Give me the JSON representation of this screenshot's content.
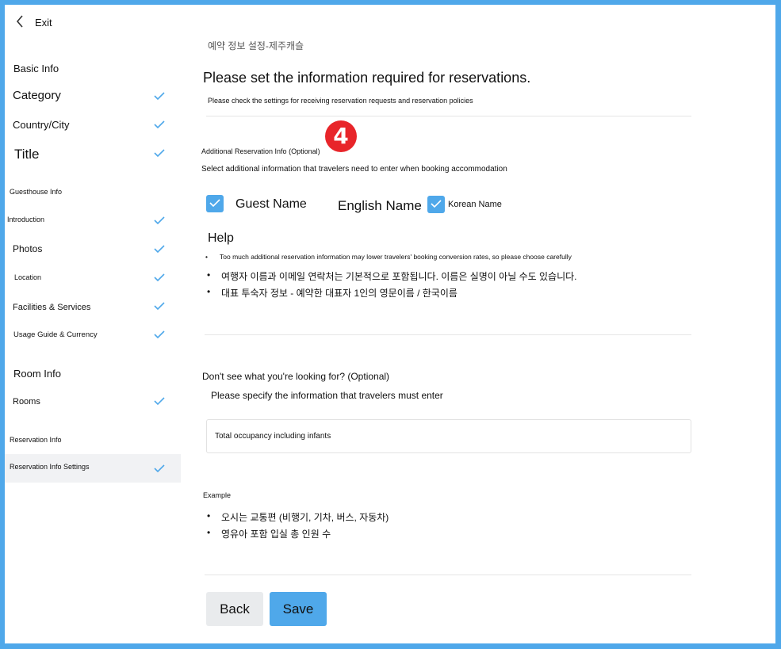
{
  "header": {
    "back_label": "Exit"
  },
  "sidebar": {
    "basic_info_heading": "Basic Info",
    "items": [
      {
        "label": "Category",
        "checked": true
      },
      {
        "label": "Country/City",
        "checked": true
      },
      {
        "label": "Title",
        "checked": true
      },
      {
        "label": "Guesthouse Info",
        "heading": true
      },
      {
        "label": "Introduction",
        "checked": true
      },
      {
        "label": "Photos",
        "checked": true
      },
      {
        "label": "Location",
        "checked": true
      },
      {
        "label": "Facilities & Services",
        "checked": true
      },
      {
        "label": "Usage Guide & Currency",
        "checked": true
      },
      {
        "label": "Room Info",
        "heading": true
      },
      {
        "label": "Rooms",
        "checked": true
      },
      {
        "label": "Reservation Info",
        "heading": true
      },
      {
        "label": "Reservation Info Settings",
        "checked": true,
        "active": true
      }
    ]
  },
  "main": {
    "breadcrumb": "예약 정보 설정-제주캐슬",
    "title": "Please set the information required for reservations.",
    "subtitle": "Please check the settings for receiving reservation requests and reservation policies",
    "step_badge": "4",
    "additional": {
      "heading": "Additional Reservation Info (Optional)",
      "description": "Select additional information that travelers need to enter when booking accommodation",
      "options": [
        {
          "label": "Guest Name",
          "checked": true
        },
        {
          "label": "English Name",
          "checked": false
        },
        {
          "label": "Korean Name",
          "checked": true
        }
      ]
    },
    "help": {
      "title": "Help",
      "items": [
        "Too much additional reservation information may lower travelers' booking conversion rates, so please choose carefully",
        "여행자 이름과 이메일 연락처는 기본적으로 포함됩니다. 이름은 실명이 아닐 수도 있습니다.",
        "대표 투숙자 정보 - 예약한 대표자 1인의 영문이름 / 한국이름"
      ]
    },
    "custom": {
      "heading": "Don't see what you're looking for? (Optional)",
      "description": "Please specify the information that travelers must enter",
      "input_value": "Total occupancy including infants"
    },
    "example": {
      "heading": "Example",
      "items": [
        "오시는 교통편 (비행기, 기차, 버스, 자동차)",
        "영유아 포함 입실 총 인원 수"
      ]
    },
    "buttons": {
      "back": "Back",
      "save": "Save"
    }
  },
  "colors": {
    "accent": "#4fa8ea",
    "badge": "#e8252a",
    "frame": "#4fa8ea"
  },
  "icons": {
    "back": "chevron-left-icon",
    "check": "check-icon"
  }
}
